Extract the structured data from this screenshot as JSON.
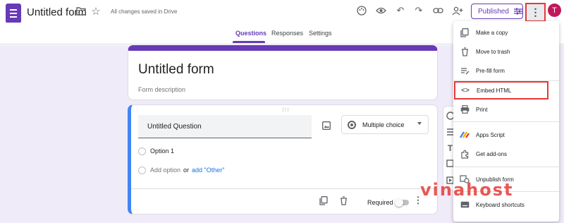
{
  "header": {
    "title": "Untitled form",
    "saved_status": "All changes saved in Drive",
    "published_label": "Published",
    "avatar_initial": "T"
  },
  "tabs": [
    {
      "label": "Questions",
      "active": true
    },
    {
      "label": "Responses",
      "active": false
    },
    {
      "label": "Settings",
      "active": false
    }
  ],
  "form": {
    "title": "Untitled form",
    "description_placeholder": "Form description"
  },
  "question": {
    "title": "Untitled Question",
    "type": "Multiple choice",
    "option1": "Option 1",
    "add_option": "Add option",
    "or_label": "or",
    "add_other": "add \"Other\"",
    "required_label": "Required",
    "required": false
  },
  "menu": {
    "items": [
      {
        "label": "Make a copy",
        "icon": "copy-icon"
      },
      {
        "label": "Move to trash",
        "icon": "trash-icon"
      },
      {
        "label": "Pre-fill form",
        "icon": "prefill-icon"
      },
      {
        "label": "Embed HTML",
        "icon": "code-icon",
        "highlighted": true
      },
      {
        "label": "Print",
        "icon": "print-icon"
      },
      {
        "label": "Apps Script",
        "icon": "apps-script-icon"
      },
      {
        "label": "Get add-ons",
        "icon": "puzzle-icon"
      },
      {
        "label": "Unpublish form",
        "icon": "unpublish-icon"
      },
      {
        "label": "Keyboard shortcuts",
        "icon": "keyboard-icon"
      }
    ]
  },
  "watermark": "vinahost",
  "colors": {
    "accent": "#673ab7",
    "highlight": "#e53935",
    "question_border": "#4285f4"
  }
}
